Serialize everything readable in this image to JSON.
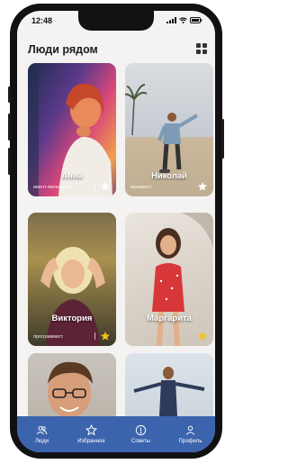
{
  "status": {
    "time": "12:48"
  },
  "header": {
    "title": "Люди рядом",
    "layout_icon": "grid-icon"
  },
  "people": [
    {
      "name": "Анна",
      "role": "ивент-менеджер",
      "favorite": false
    },
    {
      "name": "Николай",
      "role": "визажист",
      "favorite": false
    },
    {
      "name": "Виктория",
      "role": "программист",
      "favorite": true
    },
    {
      "name": "Маргарита",
      "role": "",
      "favorite": true
    },
    {
      "name": "",
      "role": "",
      "favorite": false
    },
    {
      "name": "",
      "role": "",
      "favorite": false
    }
  ],
  "nav": [
    {
      "label": "Люди",
      "icon": "people-icon"
    },
    {
      "label": "Избранное",
      "icon": "star-icon"
    },
    {
      "label": "Советы",
      "icon": "info-icon"
    },
    {
      "label": "Профиль",
      "icon": "user-icon"
    }
  ],
  "colors": {
    "accent": "#3c64ad",
    "star_active": "#f3c21a",
    "star_inactive": "#ffffff"
  }
}
